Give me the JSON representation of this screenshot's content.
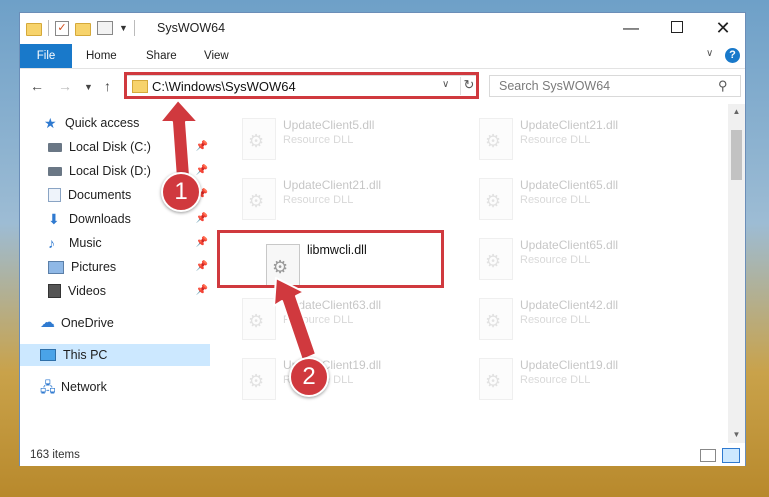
{
  "window": {
    "title": "SysWOW64"
  },
  "ribbon": {
    "tabs": [
      "File",
      "Home",
      "Share",
      "View"
    ]
  },
  "nav": {
    "address": "C:\\Windows\\SysWOW64",
    "search_placeholder": "Search SysWOW64"
  },
  "sidebar": {
    "items": [
      {
        "label": "Quick access",
        "icon": "star-icon"
      },
      {
        "label": "Local Disk (C:)",
        "icon": "disk-icon",
        "pinned": true
      },
      {
        "label": "Local Disk (D:)",
        "icon": "disk-icon",
        "pinned": true
      },
      {
        "label": "Documents",
        "icon": "documents-icon",
        "pinned": true
      },
      {
        "label": "Downloads",
        "icon": "download-icon",
        "pinned": true
      },
      {
        "label": "Music",
        "icon": "music-icon",
        "pinned": true
      },
      {
        "label": "Pictures",
        "icon": "pictures-icon",
        "pinned": true
      },
      {
        "label": "Videos",
        "icon": "videos-icon",
        "pinned": true
      },
      {
        "label": "OneDrive",
        "icon": "onedrive-icon"
      },
      {
        "label": "This PC",
        "icon": "pc-icon",
        "selected": true
      },
      {
        "label": "Network",
        "icon": "network-icon"
      }
    ]
  },
  "files": [
    {
      "name": "UpdateClient5.dll",
      "type": "Resource DLL"
    },
    {
      "name": "UpdateClient21.dll",
      "type": "Resource DLL"
    },
    {
      "name": "UpdateClient21.dll",
      "type": "Resource DLL"
    },
    {
      "name": "UpdateClient65.dll",
      "type": "Resource DLL"
    },
    {
      "name": "libmwcli.dll",
      "type": ""
    },
    {
      "name": "UpdateClient65.dll",
      "type": "Resource DLL"
    },
    {
      "name": "UpdateClient63.dll",
      "type": "Resource DLL"
    },
    {
      "name": "UpdateClient42.dll",
      "type": "Resource DLL"
    },
    {
      "name": "UpdateClient19.dll",
      "type": "Resource DLL"
    },
    {
      "name": "UpdateClient19.dll",
      "type": "Resource DLL"
    }
  ],
  "status": {
    "item_count": "163 items"
  },
  "annotations": {
    "step1": "1",
    "step2": "2",
    "color": "#d0393e"
  }
}
